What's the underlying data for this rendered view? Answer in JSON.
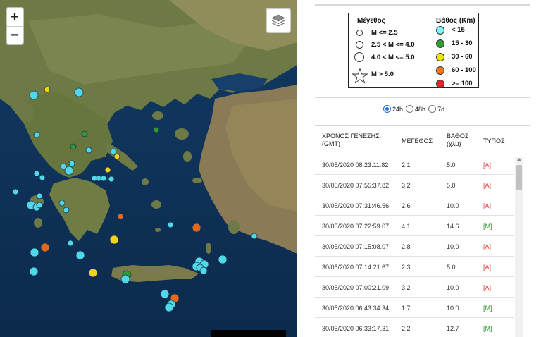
{
  "map": {
    "zoom_in": "+",
    "zoom_out": "−"
  },
  "legend": {
    "magnitude_title": "Μέγεθος",
    "depth_title": "Βάθος (Km)",
    "magnitude_classes": [
      "M <= 2.5",
      "2.5 < M <= 4.0",
      "4.0 < M <= 5.0",
      "M > 5.0"
    ],
    "depth_classes": [
      {
        "label": "< 15",
        "color": "#7ff4f4"
      },
      {
        "label": "15 - 30",
        "color": "#2e9b35"
      },
      {
        "label": "30 - 60",
        "color": "#f2e600"
      },
      {
        "label": "60 - 100",
        "color": "#f07a1a"
      },
      {
        "label": ">= 100",
        "color": "#e8242a"
      }
    ]
  },
  "filters": {
    "options": [
      {
        "label": "24h",
        "selected": true
      },
      {
        "label": "48h",
        "selected": false
      },
      {
        "label": "7d",
        "selected": false
      }
    ]
  },
  "table": {
    "headers": {
      "time": [
        "ΧΡΟΝΟΣ ΓΕΝΕΣΗΣ",
        "(GMT)"
      ],
      "magnitude": [
        "ΜΕΓΕΘΟΣ"
      ],
      "depth": [
        "ΒΑΘΟΣ",
        "(χλμ)"
      ],
      "type": [
        "ΤΥΠΟΣ"
      ]
    },
    "rows": [
      {
        "time": "30/05/2020 08:23:11.82",
        "mag": "2.1",
        "depth": "5.0",
        "type": "[A]"
      },
      {
        "time": "30/05/2020 07:55:37.82",
        "mag": "3.2",
        "depth": "5.0",
        "type": "[A]"
      },
      {
        "time": "30/05/2020 07:31:46.56",
        "mag": "2.6",
        "depth": "10.0",
        "type": "[A]"
      },
      {
        "time": "30/05/2020 07:22:59.07",
        "mag": "4.1",
        "depth": "14.6",
        "type": "[M]"
      },
      {
        "time": "30/05/2020 07:15:08.07",
        "mag": "2.8",
        "depth": "10.0",
        "type": "[A]"
      },
      {
        "time": "30/05/2020 07:14:21.67",
        "mag": "2.3",
        "depth": "5.0",
        "type": "[A]"
      },
      {
        "time": "30/05/2020 07:00:21.09",
        "mag": "3.2",
        "depth": "10.0",
        "type": "[A]"
      },
      {
        "time": "30/05/2020 06:43:34.34",
        "mag": "1.7",
        "depth": "10.0",
        "type": "[M]"
      },
      {
        "time": "30/05/2020 06:33:17.31",
        "mag": "2.2",
        "depth": "12.7",
        "type": "[M]"
      }
    ]
  }
}
